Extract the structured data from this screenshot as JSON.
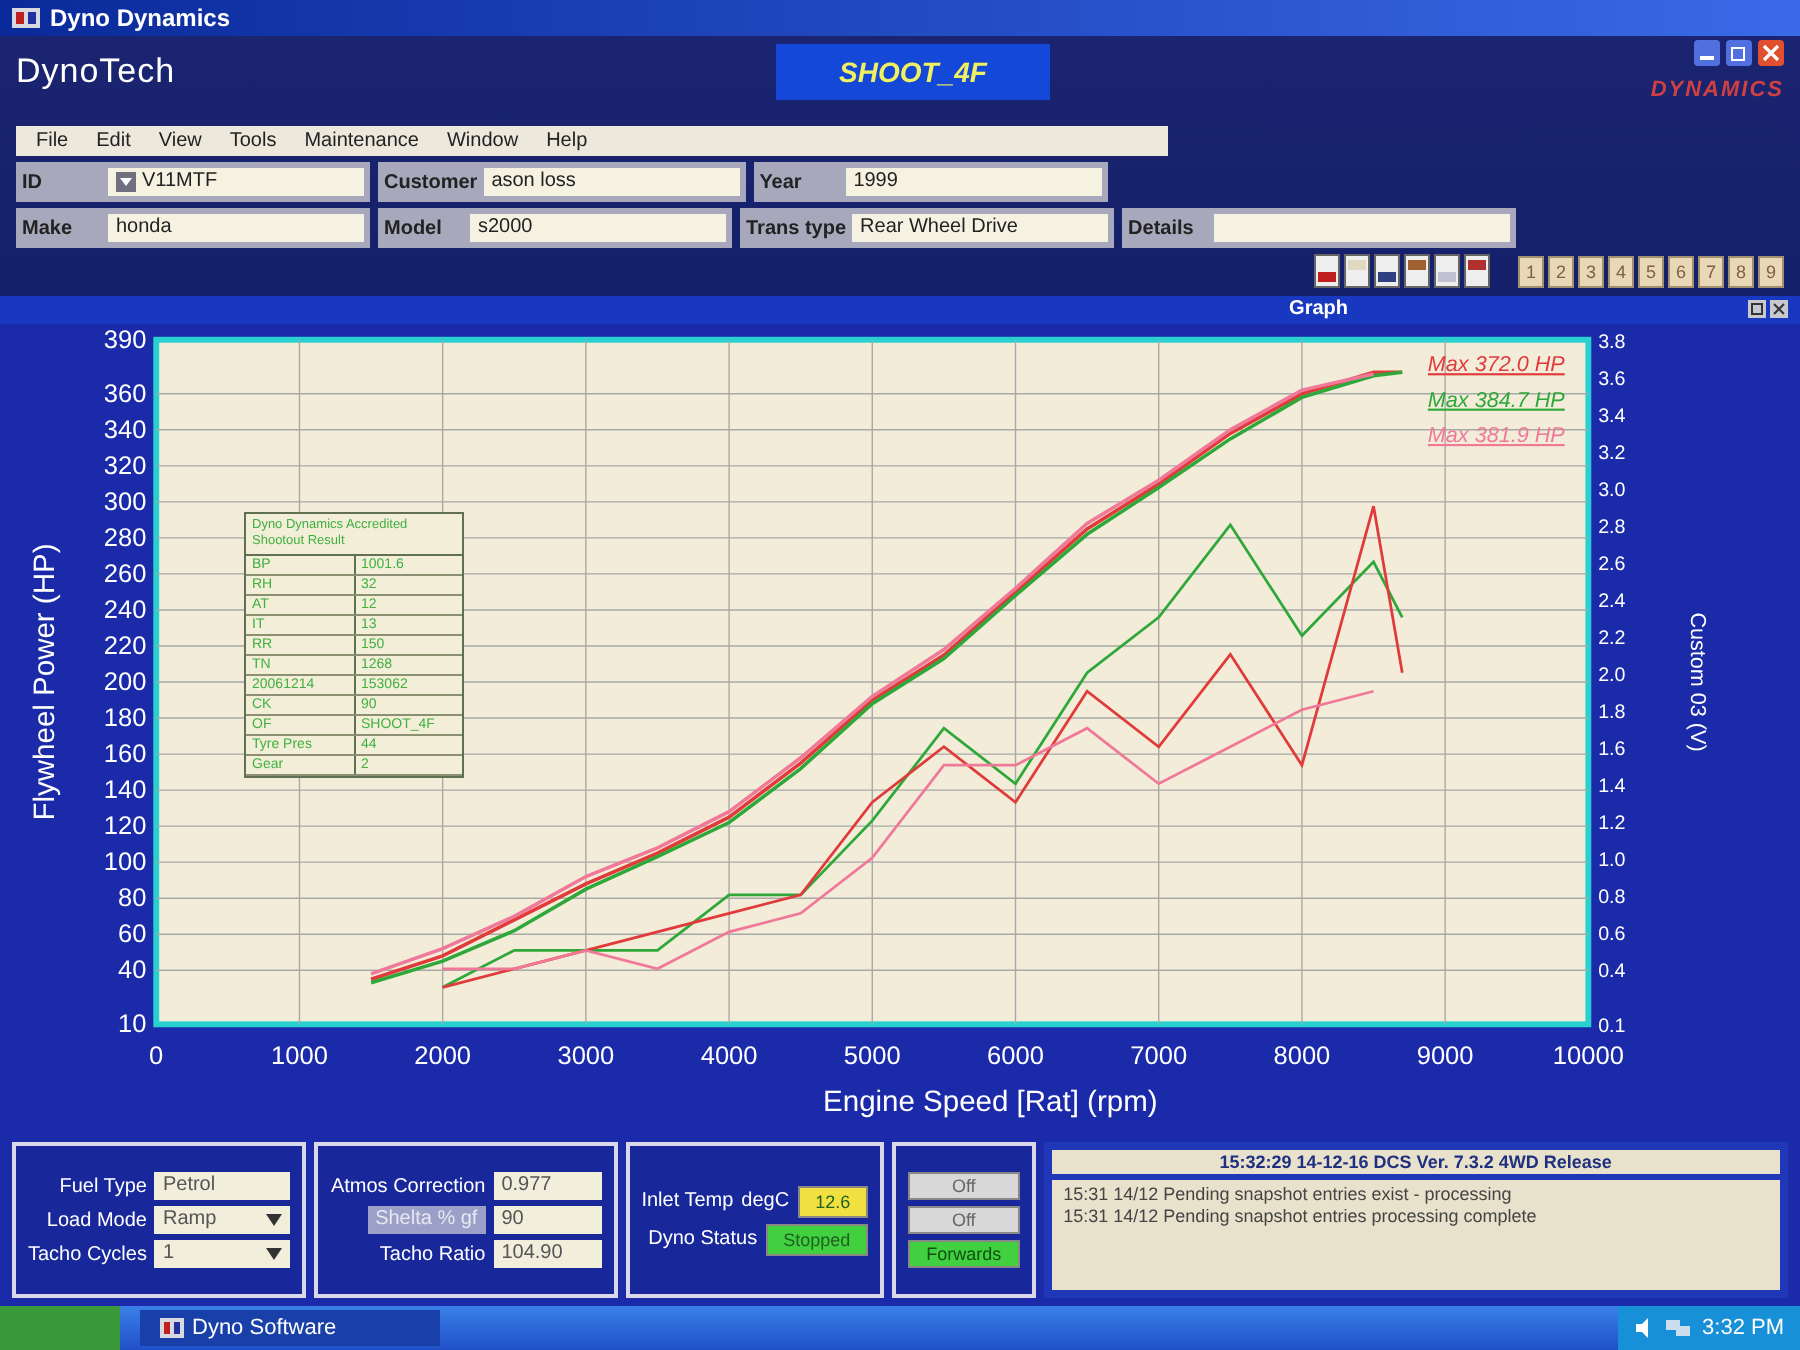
{
  "window": {
    "title": "Dyno Dynamics"
  },
  "app": {
    "name": "DynoTech",
    "run_name": "SHOOT_4F",
    "logo": "DYNAMICS"
  },
  "menu": [
    "File",
    "Edit",
    "View",
    "Tools",
    "Maintenance",
    "Window",
    "Help"
  ],
  "field_rows": [
    [
      {
        "label": "ID",
        "value": "V11MTF",
        "kind": "dropdown"
      },
      {
        "label": "Customer",
        "value": "ason loss",
        "kind": "text"
      },
      {
        "label": "Year",
        "value": "1999",
        "kind": "text"
      }
    ],
    [
      {
        "label": "Make",
        "value": "honda",
        "kind": "text"
      },
      {
        "label": "Model",
        "value": "s2000",
        "kind": "text"
      },
      {
        "label": "Trans type",
        "value": "Rear Wheel Drive",
        "kind": "text"
      },
      {
        "label": "Details",
        "kind": "text"
      }
    ]
  ],
  "run_buttons": [
    "1",
    "2",
    "3",
    "4",
    "5",
    "6",
    "7",
    "8",
    "9"
  ],
  "graph": {
    "title": "Graph",
    "info_table": {
      "title": "Dyno Dynamics Accredited Shootout Result",
      "rows": [
        {
          "key": "BP",
          "value": "1001.6"
        },
        {
          "key": "RH",
          "value": "32"
        },
        {
          "key": "AT",
          "value": "12"
        },
        {
          "key": "IT",
          "value": "13"
        },
        {
          "key": "RR",
          "value": "150"
        },
        {
          "key": "TN",
          "value": "1268"
        },
        {
          "key": "20061214",
          "value": "153062"
        },
        {
          "key": "CK",
          "value": "90"
        },
        {
          "key": "OF",
          "value": "SHOOT_4F"
        },
        {
          "key": "Tyre Pres",
          "value": "44"
        },
        {
          "key": "Gear",
          "value": "2"
        }
      ]
    },
    "chart_data": {
      "type": "line",
      "xlabel": "Engine Speed [Rat] (rpm)",
      "ylabel": "Flywheel Power (HP)",
      "y2label": "Custom 03 (V)",
      "x": [
        1500,
        2000,
        2500,
        3000,
        3500,
        4000,
        4500,
        5000,
        5500,
        6000,
        6500,
        7000,
        7500,
        8000,
        8500,
        8700
      ],
      "grid": true,
      "xlim": [
        0,
        10000
      ],
      "ylim": [
        10,
        390
      ],
      "y2lim": [
        0.1,
        3.8
      ],
      "xticks": [
        0,
        1000,
        2000,
        3000,
        4000,
        5000,
        6000,
        7000,
        8000,
        9000,
        10000
      ],
      "yticks": [
        10,
        40,
        60,
        80,
        100,
        120,
        140,
        160,
        180,
        200,
        220,
        240,
        260,
        280,
        300,
        320,
        340,
        360,
        390
      ],
      "y2ticks": [
        0.1,
        0.4,
        0.6,
        0.8,
        {
          "value": 1,
          "label": "1.0"
        },
        1.2,
        1.4,
        1.6,
        1.8,
        {
          "value": 2,
          "label": "2.0"
        },
        2.2,
        2.4,
        2.6,
        2.8,
        {
          "value": 3,
          "label": "3.0"
        },
        3.2,
        3.4,
        3.6,
        3.8
      ],
      "series": [
        {
          "name": "Max 372.0 HP",
          "color": "#e03a3a",
          "values": [
            35,
            48,
            68,
            88,
            105,
            125,
            155,
            190,
            215,
            250,
            285,
            310,
            338,
            360,
            372,
            372
          ]
        },
        {
          "name": "Max 384.7 HP",
          "color": "#2ea83a",
          "values": [
            33,
            45,
            62,
            85,
            103,
            122,
            152,
            188,
            213,
            248,
            282,
            308,
            335,
            358,
            370,
            372
          ]
        },
        {
          "name": "Max 381.9 HP",
          "color": "#f07898",
          "values": [
            38,
            52,
            70,
            92,
            108,
            128,
            158,
            192,
            218,
            252,
            288,
            312,
            340,
            362,
            371,
            null
          ]
        },
        {
          "color": "#2ea83a",
          "axis": "y2",
          "values": [
            null,
            0.3,
            0.5,
            0.5,
            0.5,
            0.8,
            0.8,
            1.2,
            1.7,
            1.4,
            2.0,
            2.3,
            2.8,
            2.2,
            2.6,
            2.3
          ]
        },
        {
          "color": "#e03a3a",
          "axis": "y2",
          "values": [
            null,
            0.3,
            0.4,
            0.5,
            0.6,
            0.7,
            0.8,
            1.3,
            1.6,
            1.3,
            1.9,
            1.6,
            2.1,
            1.5,
            2.9,
            2.0
          ]
        },
        {
          "color": "#f07898",
          "axis": "y2",
          "values": [
            null,
            0.4,
            0.4,
            0.5,
            0.4,
            0.6,
            0.7,
            1.0,
            1.5,
            1.5,
            1.7,
            1.4,
            1.6,
            1.8,
            1.9,
            null
          ]
        }
      ]
    }
  },
  "settings": [
    {
      "label": "Fuel Type",
      "value": "Petrol",
      "kind": "text"
    },
    {
      "label": "Load Mode",
      "value": "Ramp",
      "kind": "dropdown"
    },
    {
      "label": "Tacho Cycles",
      "value": "1",
      "kind": "dropdown"
    }
  ],
  "corrections": [
    {
      "label": "Atmos Correction",
      "value": "0.977",
      "disabled": false
    },
    {
      "label": "Shelta % gf",
      "value": "90",
      "disabled": true
    },
    {
      "label": "Tacho Ratio",
      "value": "104.90",
      "disabled": false
    }
  ],
  "readings": [
    {
      "label": "Inlet Temp",
      "unit": "degC",
      "value": "12.6",
      "color": "#f0e040"
    },
    {
      "label": "Dyno Status",
      "value": "Stopped",
      "color": "#40d040"
    }
  ],
  "switches": [
    {
      "label": "Off",
      "on": false
    },
    {
      "label": "Off",
      "on": false
    },
    {
      "label": "Forwards",
      "on": true
    }
  ],
  "status": {
    "header": "15:32:29   14-12-16 DCS Ver. 7.3.2 4WD Release",
    "log": [
      "15:31 14/12 Pending snapshot entries exist - processing",
      "15:31 14/12 Pending snapshot entries processing complete"
    ]
  },
  "taskbar": {
    "app": "Dyno Software",
    "time": "3:32 PM"
  }
}
